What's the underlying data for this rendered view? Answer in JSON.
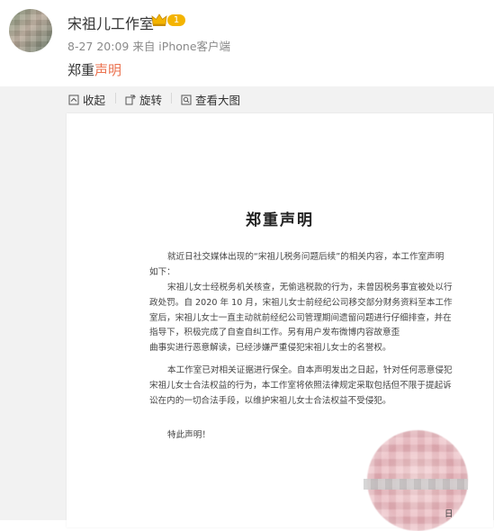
{
  "header": {
    "name": "宋祖儿工作室",
    "level": "1",
    "meta": "8-27 20:09 来自 iPhone客户端",
    "title_prefix": "郑重",
    "title_accent": "声明"
  },
  "toolbar": {
    "collapse": "收起",
    "rotate": "旋转",
    "view_large": "查看大图"
  },
  "document": {
    "title": "郑重声明",
    "p1": [
      "就近日社交媒体出现的“宋祖儿税务问题后续”的相关内容，本工作室声明",
      "如下："
    ],
    "p2": [
      "宋祖儿女士经税务机关核查，无偷逃税款的行为，未曾因税务事宜被处以行",
      "政处罚。自 2020 年 10 月，宋祖儿女士前经纪公司移交部分财务资料至本工作",
      "室后，宋祖儿女士一直主动就前经纪公司管理期间遗留问题进行仔细排查，并在",
      "指导下，积极完成了自查自纠工作。另有用户发布微博内容故意歪",
      "曲事实进行恶意解读，已经涉嫌严重侵犯宋祖儿女士的名誉权。"
    ],
    "p3": [
      "本工作室已对相关证据进行保全。自本声明发出之日起，针对任何恶意侵犯",
      "宋祖儿女士合法权益的行为，本工作室将依照法律规定采取包括但不限于提起诉",
      "讼在内的一切合法手段，以维护宋祖儿女士合法权益不受侵犯。"
    ],
    "closing": "特此声明！",
    "date": "日"
  }
}
